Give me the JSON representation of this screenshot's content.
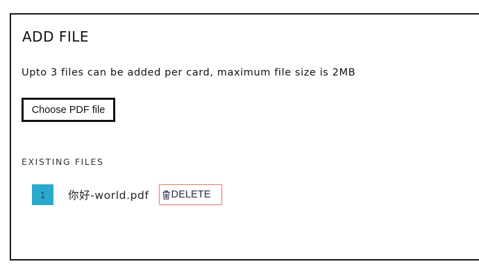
{
  "dialog": {
    "title": "ADD FILE",
    "info_text": "Upto 3 files can be added per card, maximum file size is 2MB",
    "choose_button_label": "Choose PDF file"
  },
  "existing_files": {
    "label": "EXISTING FILES",
    "files": [
      {
        "index": "1",
        "name": "你好-world.pdf",
        "delete_label": "DELETE",
        "delete_icon": "trash-icon"
      }
    ]
  },
  "colors": {
    "badge_background": "#2aa9cc",
    "delete_border": "#e8826f",
    "panel_border": "#1a1a1a"
  }
}
